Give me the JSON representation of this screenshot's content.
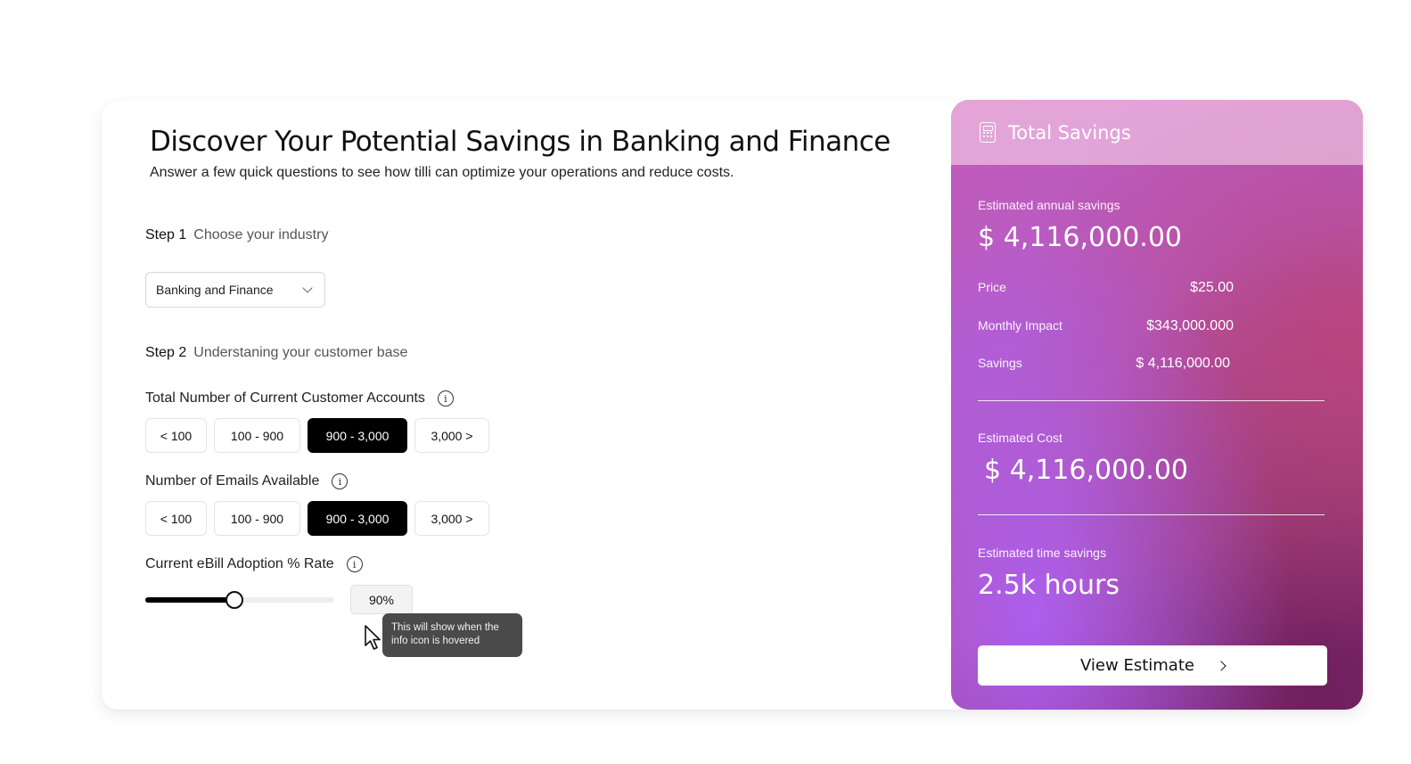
{
  "header": {
    "title": "Discover Your Potential Savings in Banking and Finance",
    "subtitle": "Answer a few quick questions to see how tilli can optimize your operations and reduce costs."
  },
  "step1": {
    "num": "Step 1",
    "desc": "Choose your industry",
    "selected_industry": "Banking and Finance"
  },
  "step2": {
    "num": "Step 2",
    "desc": "Understaning your customer base"
  },
  "questions": {
    "accounts": {
      "label": "Total Number of Current Customer Accounts",
      "options": [
        "< 100",
        "100 - 900",
        "900 - 3,000",
        "3,000 >"
      ],
      "selected": "900 - 3,000"
    },
    "emails": {
      "label": "Number of Emails Available",
      "options": [
        "< 100",
        "100 - 900",
        "900 - 3,000",
        "3,000 >"
      ],
      "selected": "900 - 3,000"
    },
    "ebill": {
      "label": "Current eBill Adoption % Rate",
      "value_label": "90%",
      "slider_fraction": 0.47
    }
  },
  "tooltip": {
    "text": "This will show when the info icon is hovered"
  },
  "panel": {
    "title": "Total Savings",
    "annual_label": "Estimated annual savings",
    "annual_value": "$ 4,116,000.00",
    "price_label": "Price",
    "price_value": "$25.00",
    "monthly_label": "Monthly Impact",
    "monthly_value": "$343,000.000",
    "savings_label": "Savings",
    "savings_value": "$ 4,116,000.00",
    "cost_label": "Estimated Cost",
    "cost_value": "$ 4,116,000.00",
    "time_label": "Estimated time savings",
    "time_value": "2.5k hours",
    "button_label": "View Estimate"
  },
  "colors": {
    "active_option": "#000000",
    "tooltip": "#4a4a4a"
  }
}
